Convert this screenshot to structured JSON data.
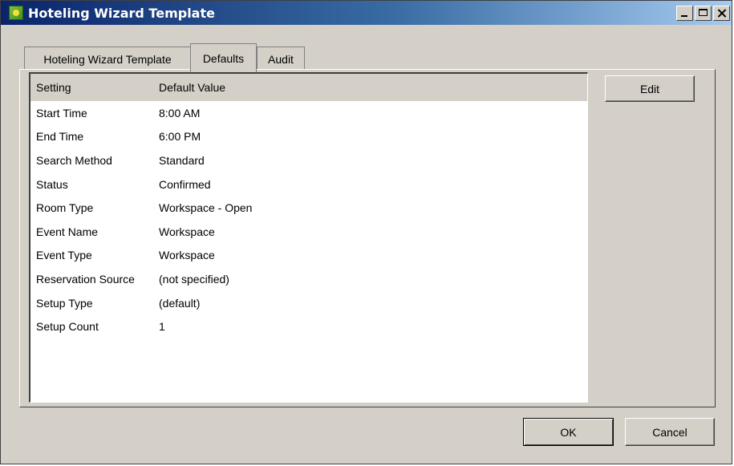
{
  "window": {
    "title": "Hoteling Wizard Template"
  },
  "tabs": [
    {
      "label": "Hoteling Wizard Template",
      "selected": false
    },
    {
      "label": "Defaults",
      "selected": true
    },
    {
      "label": "Audit",
      "selected": false
    }
  ],
  "defaults_list": {
    "columns": [
      "Setting",
      "Default Value"
    ],
    "rows": [
      [
        "Start Time",
        "8:00 AM"
      ],
      [
        "End Time",
        "6:00 PM"
      ],
      [
        "Search Method",
        "Standard"
      ],
      [
        "Status",
        "Confirmed"
      ],
      [
        "Room Type",
        "Workspace - Open"
      ],
      [
        "Event Name",
        "Workspace"
      ],
      [
        "Event Type",
        "Workspace"
      ],
      [
        "Reservation Source",
        "(not specified)"
      ],
      [
        "Setup Type",
        "(default)"
      ],
      [
        "Setup Count",
        "1"
      ]
    ]
  },
  "buttons": {
    "edit": "Edit",
    "ok": "OK",
    "cancel": "Cancel"
  },
  "colors": {
    "title_start": "#0a246a",
    "title_end": "#a6caf0",
    "face": "#d4d0c8"
  }
}
